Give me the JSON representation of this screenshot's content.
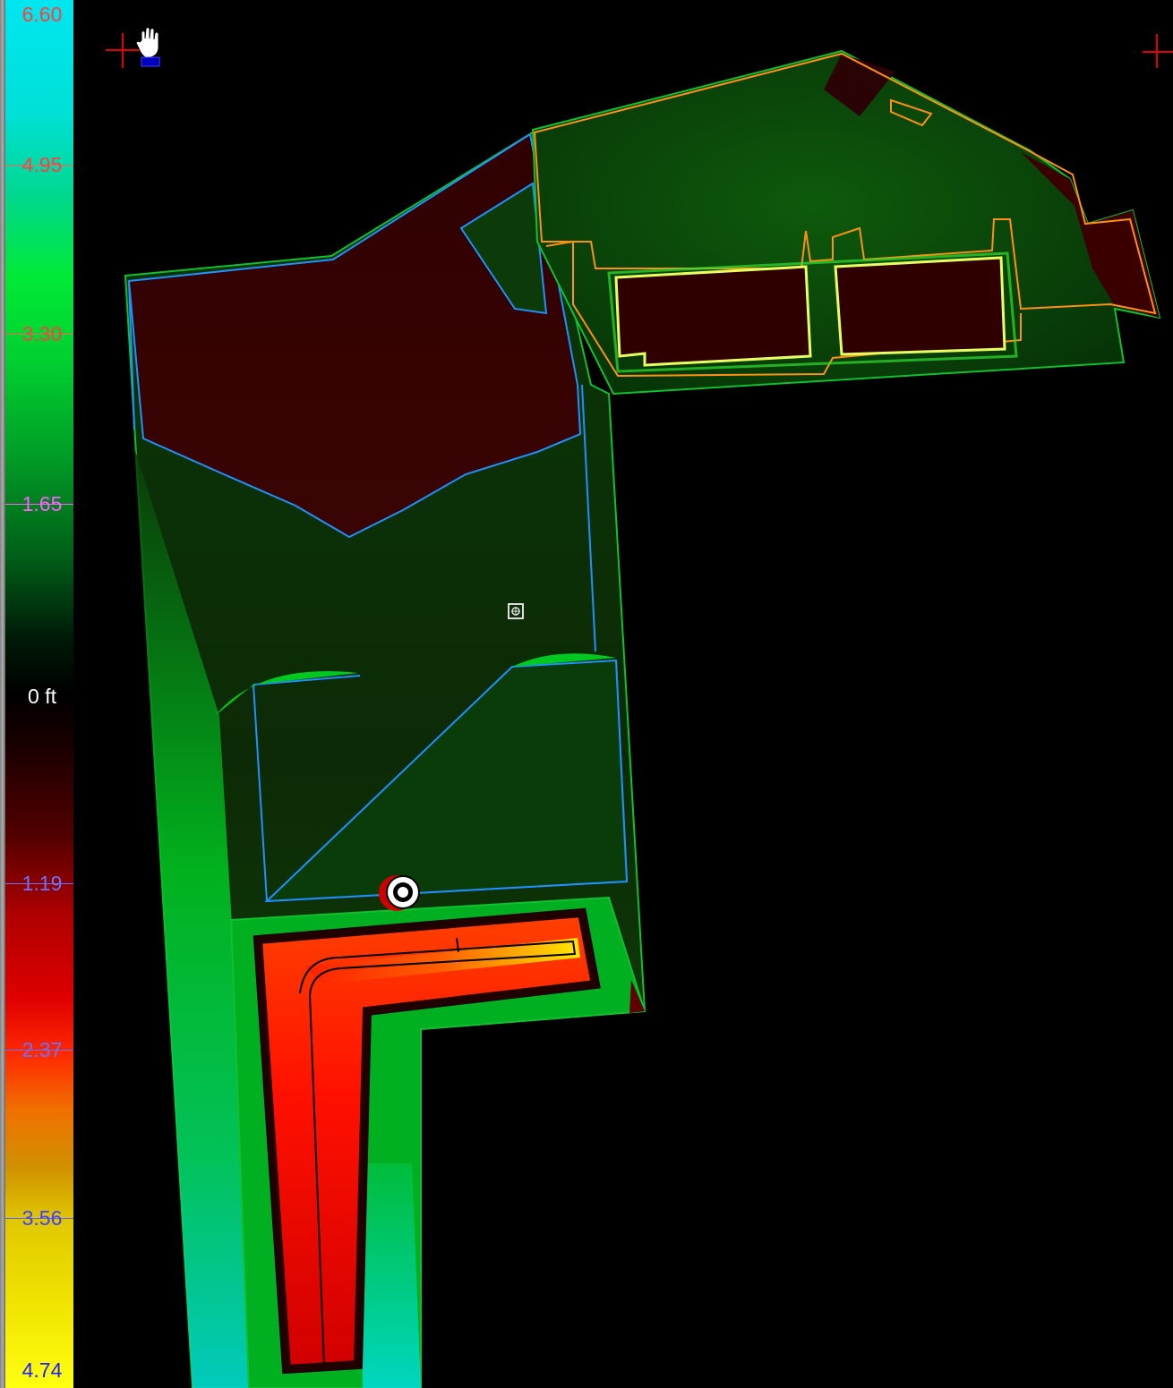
{
  "legend": {
    "ticks": [
      {
        "label": "6.60",
        "color": "#ff4040"
      },
      {
        "label": "4.95",
        "color": "#ff4040"
      },
      {
        "label": "3.30",
        "color": "#ff4040"
      },
      {
        "label": "1.65",
        "color": "#ff60ff"
      },
      {
        "label": "0 ft",
        "color": "#ffffff"
      },
      {
        "label": "1.19",
        "color": "#7070ff"
      },
      {
        "label": "2.37",
        "color": "#7070ff"
      },
      {
        "label": "3.56",
        "color": "#4040ff"
      },
      {
        "label": "4.74",
        "color": "#2020ff"
      }
    ]
  },
  "icons": {
    "pan_tool": "hand-icon",
    "corner_marker": "crosshair-icon",
    "target": "target-icon",
    "benchmark": "benchmark-icon"
  },
  "colors": {
    "fill_dark": "#3a0000",
    "cut_green": "#007a10",
    "boundary_blue": "#2090ff",
    "boundary_orange": "#ff9010",
    "boundary_green": "#10c030"
  }
}
